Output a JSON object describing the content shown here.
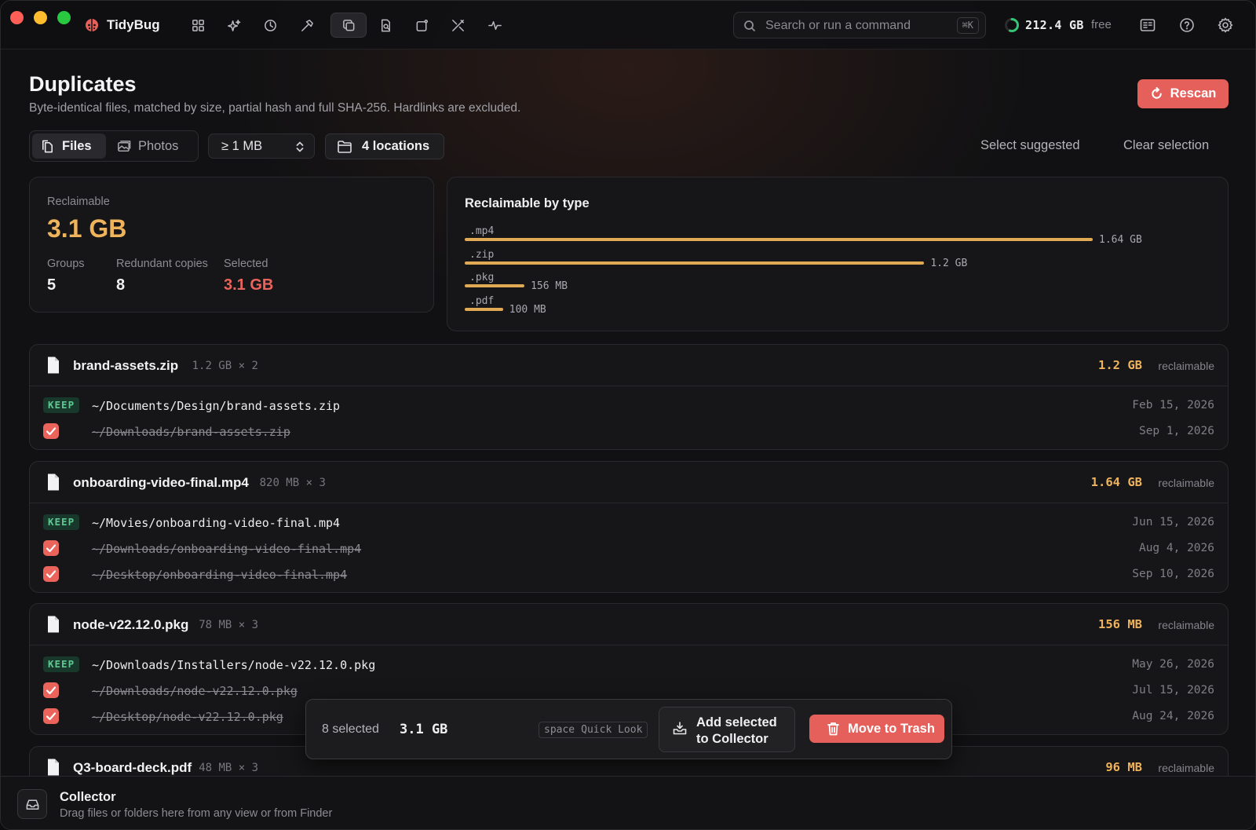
{
  "app": {
    "name": "TidyBug",
    "search_placeholder": "Search or run a command",
    "search_shortcut": "⌘K",
    "disk_free_value": "212.4 GB",
    "disk_free_label": "free",
    "disk_used_fraction": 0.55,
    "accent_color": "#e5605a",
    "warn_color": "#eeb35b",
    "ok_color": "#34c474",
    "nav_icons": [
      "grid-icon",
      "sparkle-icon",
      "pie-clock-icon",
      "hammer-icon",
      "duplicates-icon",
      "document-search-icon",
      "app-window-icon",
      "tools-icon",
      "pulse-icon"
    ],
    "active_nav": "duplicates-icon"
  },
  "header": {
    "title": "Duplicates",
    "subtitle": "Byte-identical files, matched by size, partial hash and full SHA-256. Hardlinks are excluded.",
    "rescan_label": "Rescan"
  },
  "controls": {
    "tabs": [
      {
        "label": "Files",
        "icon": "files-icon",
        "active": true
      },
      {
        "label": "Photos",
        "icon": "photos-icon",
        "active": false
      }
    ],
    "min_size": "≥ 1 MB",
    "locations": "4 locations",
    "select_suggested": "Select suggested",
    "clear_selection": "Clear selection"
  },
  "summary": {
    "reclaimable_label": "Reclaimable",
    "reclaimable_value": "3.1 GB",
    "groups_label": "Groups",
    "groups_value": "5",
    "redundant_label": "Redundant copies",
    "redundant_value": "8",
    "selected_label": "Selected",
    "selected_value": "3.1 GB"
  },
  "by_type": {
    "title": "Reclaimable by type",
    "items": [
      {
        "ext": ".mp4",
        "value_mb": 1640,
        "label": "1.64 GB"
      },
      {
        "ext": ".zip",
        "value_mb": 1200,
        "label": "1.2 GB"
      },
      {
        "ext": ".pkg",
        "value_mb": 156,
        "label": "156 MB"
      },
      {
        "ext": ".pdf",
        "value_mb": 100,
        "label": "100 MB"
      }
    ]
  },
  "groups": [
    {
      "name": "brand-assets.zip",
      "meta": "1.2 GB × 2",
      "reclaim": "1.2 GB",
      "reclaim_label": "reclaimable",
      "files": [
        {
          "keep": true,
          "path": "~/Documents/Design/brand-assets.zip",
          "date": "Feb 15, 2026"
        },
        {
          "keep": false,
          "path": "~/Downloads/brand-assets.zip",
          "date": "Sep 1, 2026"
        }
      ]
    },
    {
      "name": "onboarding-video-final.mp4",
      "meta": "820 MB × 3",
      "reclaim": "1.64 GB",
      "reclaim_label": "reclaimable",
      "files": [
        {
          "keep": true,
          "path": "~/Movies/onboarding-video-final.mp4",
          "date": "Jun 15, 2026"
        },
        {
          "keep": false,
          "path": "~/Downloads/onboarding-video-final.mp4",
          "date": "Aug 4, 2026"
        },
        {
          "keep": false,
          "path": "~/Desktop/onboarding-video-final.mp4",
          "date": "Sep 10, 2026"
        }
      ]
    },
    {
      "name": "node-v22.12.0.pkg",
      "meta": "78 MB × 3",
      "reclaim": "156 MB",
      "reclaim_label": "reclaimable",
      "files": [
        {
          "keep": true,
          "path": "~/Downloads/Installers/node-v22.12.0.pkg",
          "date": "May 26, 2026"
        },
        {
          "keep": false,
          "path": "~/Downloads/node-v22.12.0.pkg",
          "date": "Jul 15, 2026"
        },
        {
          "keep": false,
          "path": "~/Desktop/node-v22.12.0.pkg",
          "date": "Aug 24, 2026"
        }
      ]
    },
    {
      "name": "Q3-board-deck.pdf",
      "meta": "48 MB × 3",
      "reclaim": "96 MB",
      "reclaim_label": "reclaimable",
      "files": []
    }
  ],
  "keep_badge": "KEEP",
  "action_bar": {
    "count": "8 selected",
    "size": "3.1 GB",
    "hint_key": "space",
    "hint_label": "Quick Look",
    "add_label": "Add selected to Collector",
    "trash_label": "Move to Trash"
  },
  "collector": {
    "title": "Collector",
    "subtitle": "Drag files or folders here from any view or from Finder"
  }
}
